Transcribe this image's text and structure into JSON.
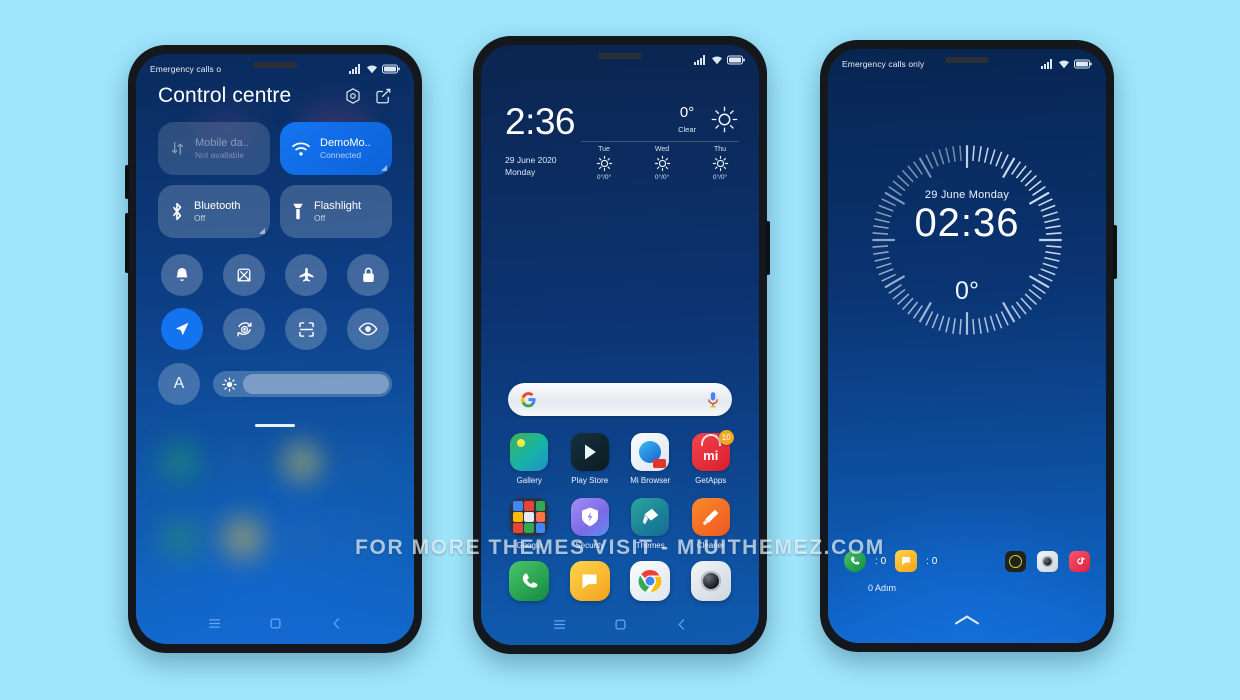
{
  "background_color": "#9fe6fb",
  "watermark": "FOR MORE THEMES VISIT - MIUITHEMEZ.COM",
  "accent_color": "#1474f0",
  "phone1": {
    "name": "control-centre-screen",
    "statusbar": {
      "carrier": "Emergency calls o",
      "icons": [
        "signal-icon",
        "wifi-icon",
        "battery-icon"
      ]
    },
    "title": "Control centre",
    "actions": [
      {
        "icon": "privacy-hexagon-icon",
        "name": "privacy-settings-button"
      },
      {
        "icon": "edit-square-icon",
        "name": "edit-tiles-button"
      }
    ],
    "tiles": [
      {
        "name": "Mobile da..",
        "sub": "Not available",
        "state": "disabled",
        "icon": "mobile-data-icon"
      },
      {
        "name": "DemoMo..",
        "sub": "Connected",
        "state": "on",
        "icon": "wifi-icon"
      },
      {
        "name": "Bluetooth",
        "sub": "Off",
        "state": "off",
        "icon": "bluetooth-icon"
      },
      {
        "name": "Flashlight",
        "sub": "Off",
        "state": "off",
        "icon": "flashlight-icon"
      }
    ],
    "toggles": [
      {
        "icon": "bell-icon",
        "active": false
      },
      {
        "icon": "screenshot-icon",
        "active": false
      },
      {
        "icon": "airplane-icon",
        "active": false
      },
      {
        "icon": "lock-icon",
        "active": false
      },
      {
        "icon": "location-icon",
        "active": true
      },
      {
        "icon": "auto-rotate-icon",
        "active": false
      },
      {
        "icon": "scan-icon",
        "active": false
      },
      {
        "icon": "eye-icon",
        "active": false
      }
    ],
    "brightness": {
      "auto_label": "A",
      "icon": "brightness-sun-icon",
      "value": 88
    },
    "navbar": [
      "recents-icon",
      "home-icon",
      "back-icon"
    ]
  },
  "phone2": {
    "name": "home-screen",
    "statusbar": {
      "carrier": "",
      "icons": [
        "signal-icon",
        "wifi-icon",
        "battery-icon"
      ]
    },
    "clock_widget": {
      "time": "2:36",
      "date": "29 June 2020",
      "weekday": "Monday",
      "temperature": "0°",
      "condition": "Clear",
      "weather_icon": "sun-icon",
      "forecast": [
        {
          "day": "Tue",
          "icon": "sun-icon",
          "temps": "0°/0°"
        },
        {
          "day": "Wed",
          "icon": "sun-icon",
          "temps": "0°/0°"
        },
        {
          "day": "Thu",
          "icon": "sun-icon",
          "temps": "0°/0°"
        }
      ]
    },
    "search": {
      "left_icon": "google-g-icon",
      "right_icon": "microphone-icon",
      "placeholder": ""
    },
    "apps_row1": [
      {
        "label": "Gallery",
        "icon": "gallery-icon"
      },
      {
        "label": "Play Store",
        "icon": "play-store-icon"
      },
      {
        "label": "Mi Browser",
        "icon": "mi-browser-icon"
      },
      {
        "label": "GetApps",
        "icon": "getapps-icon",
        "badge": "10"
      }
    ],
    "apps_row2": [
      {
        "label": "Google",
        "icon": "google-folder-icon"
      },
      {
        "label": "Security",
        "icon": "security-shield-icon"
      },
      {
        "label": "Themes",
        "icon": "themes-brush-icon"
      },
      {
        "label": "Cleaner",
        "icon": "cleaner-broom-icon"
      }
    ],
    "dock": [
      {
        "label": "Phone",
        "icon": "phone-icon"
      },
      {
        "label": "Messages",
        "icon": "messages-icon"
      },
      {
        "label": "Chrome",
        "icon": "chrome-icon"
      },
      {
        "label": "Camera",
        "icon": "camera-icon"
      }
    ],
    "navbar": [
      "recents-icon",
      "home-icon",
      "back-icon"
    ]
  },
  "phone3": {
    "name": "lock-screen",
    "statusbar": {
      "carrier": "Emergency calls only",
      "icons": [
        "signal-icon",
        "wifi-icon",
        "battery-icon"
      ]
    },
    "date": "29 June Monday",
    "time": "02:36",
    "temperature": "0°",
    "notifications": [
      {
        "icon": "phone-icon",
        "separator": ":",
        "count": "0"
      },
      {
        "icon": "messages-icon",
        "separator": ":",
        "count": "0"
      }
    ],
    "shortcuts": [
      {
        "icon": "torch-round-icon"
      },
      {
        "icon": "camera-icon"
      },
      {
        "icon": "tiktok-icon"
      }
    ],
    "steps": "0 Adım",
    "unlock_hint_icon": "chevron-up-icon"
  }
}
